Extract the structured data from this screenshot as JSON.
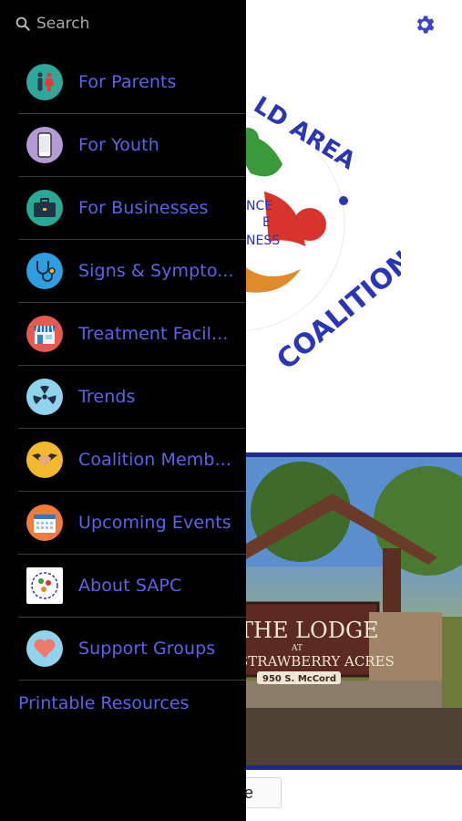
{
  "search": {
    "placeholder": "Search"
  },
  "menu": {
    "items": [
      {
        "label": "For Parents",
        "icon": "parents-icon",
        "color": "#2fa89b"
      },
      {
        "label": "For Youth",
        "icon": "phone-icon",
        "color": "#b39bd6"
      },
      {
        "label": "For Businesses",
        "icon": "briefcase-icon",
        "color": "#2aa896"
      },
      {
        "label": "Signs & Sympto...",
        "icon": "stethoscope-icon",
        "color": "#2e9ee0"
      },
      {
        "label": "Treatment Facil...",
        "icon": "storefront-icon",
        "color": "#e85a4f"
      },
      {
        "label": "Trends",
        "icon": "radiation-icon",
        "color": "#8fd3ec"
      },
      {
        "label": "Coalition Memb...",
        "icon": "handshake-icon",
        "color": "#f2b92c"
      },
      {
        "label": "Upcoming Events",
        "icon": "calendar-icon",
        "color": "#f07b3a"
      },
      {
        "label": "About SAPC",
        "icon": "sapc-logo-icon",
        "color": "#ffffff"
      },
      {
        "label": "Support Groups",
        "icon": "heart-icon",
        "color": "#8fd3ec"
      }
    ],
    "printable_label": "Printable Resources"
  },
  "background": {
    "logo": {
      "arc_text": "LD AREA",
      "middle_text_1": "NCE",
      "middle_text_2": "E",
      "middle_text_3": "NESS",
      "bottom_text": "COALITION"
    },
    "photo": {
      "sign_line1": "THE LODGE",
      "sign_line2": "AT",
      "sign_line3": "STRAWBERRY ACRES",
      "sign_address": "950 S. McCord"
    },
    "button_label": "e"
  },
  "colors": {
    "accent": "#5b63e6",
    "drawer_bg": "#000000",
    "frame": "#1f2a8a"
  }
}
